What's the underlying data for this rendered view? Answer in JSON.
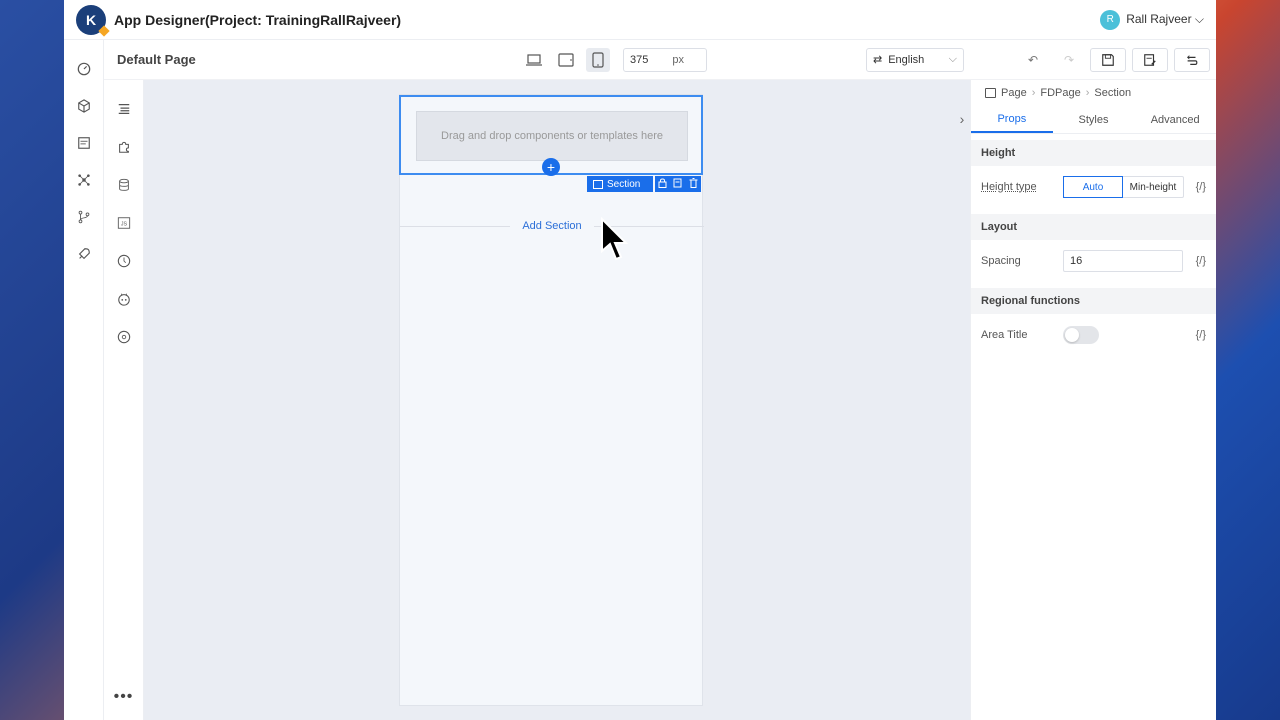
{
  "app": {
    "logo_letter": "K",
    "title": "App Designer(Project: TrainingRallRajveer)",
    "user_initial": "R",
    "user_name": "Rall Rajveer ⌵"
  },
  "toolbar": {
    "page_name": "Default Page",
    "width_value": "375",
    "width_unit": "px",
    "language": "English"
  },
  "canvas": {
    "drop_hint": "Drag and drop components or templates here",
    "section_tag": "Section",
    "add_section": "Add Section"
  },
  "right_panel": {
    "breadcrumb": [
      "Page",
      "FDPage",
      "Section"
    ],
    "tabs": [
      "Props",
      "Styles",
      "Advanced"
    ],
    "groups": {
      "height": "Height",
      "layout": "Layout",
      "regional": "Regional functions"
    },
    "height_type_label": "Height type",
    "height_options": [
      "Auto",
      "Min-height"
    ],
    "spacing_label": "Spacing",
    "spacing_value": "16",
    "area_title_label": "Area Title",
    "fx": "{/}"
  },
  "colors": {
    "accent": "#1a6eea",
    "selection": "#3d8cf0"
  }
}
